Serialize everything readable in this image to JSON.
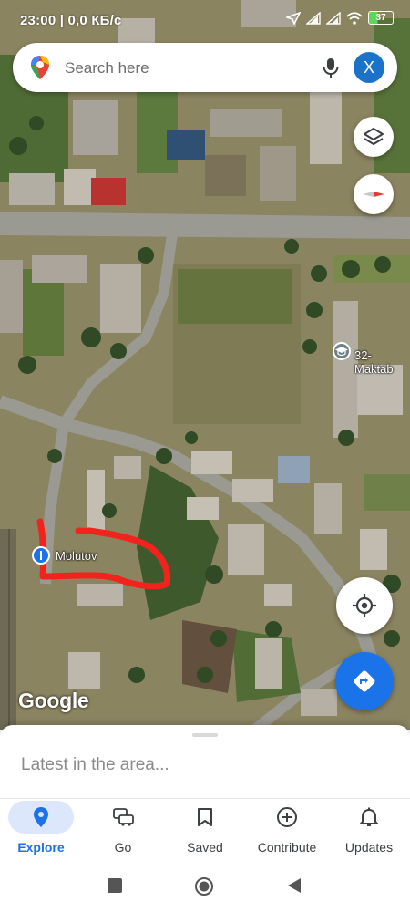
{
  "status_bar": {
    "time_speed": "23:00 | 0,0 КБ/с",
    "battery": "37"
  },
  "search": {
    "placeholder": "Search here",
    "avatar_letter": "X"
  },
  "map": {
    "labels": {
      "school": "32-Maktab",
      "place": "Molutov"
    },
    "attribution": "Google",
    "colors": {
      "annotation_stroke": "#f2231c",
      "road": "#9a9a92"
    }
  },
  "sheet": {
    "title": "Latest in the area..."
  },
  "nav": {
    "items": [
      {
        "label": "Explore",
        "icon": "pin-icon",
        "active": true
      },
      {
        "label": "Go",
        "icon": "car-icon",
        "active": false
      },
      {
        "label": "Saved",
        "icon": "bookmark-icon",
        "active": false
      },
      {
        "label": "Contribute",
        "icon": "plus-circle-icon",
        "active": false
      },
      {
        "label": "Updates",
        "icon": "bell-icon",
        "active": false
      }
    ],
    "accent_color": "#1a73e8"
  }
}
